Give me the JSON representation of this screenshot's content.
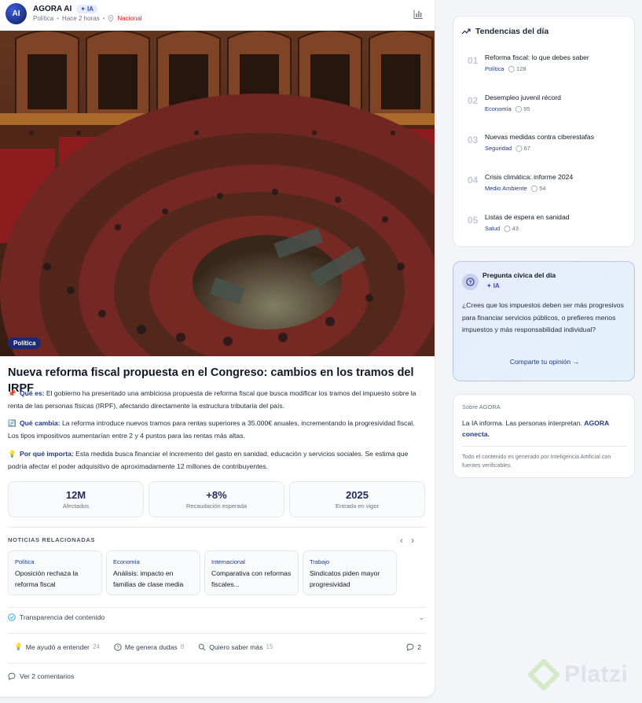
{
  "post": {
    "author": "AGORA AI",
    "avatar_initials": "AI",
    "ia_badge": "IA",
    "category": "Política",
    "time": "Hace 2 horas",
    "location": "Nacional",
    "image_category": "Política",
    "headline": "Nueva reforma fiscal propuesta en el Congreso: cambios en los tramos del IRPF",
    "sections": [
      {
        "label": "Qué es:",
        "text": "El gobierno ha presentado una ambiciosa propuesta de reforma fiscal que busca modificar los tramos del impuesto sobre la renta de las personas físicas (IRPF), afectando directamente la estructura tributaria del país."
      },
      {
        "label": "Qué cambia:",
        "text": "La reforma introduce nuevos tramos para rentas superiores a 35.000€ anuales, incrementando la progresividad fiscal. Los tipos impositivos aumentarían entre 2 y 4 puntos para las rentas más altas."
      },
      {
        "label": "Por qué importa:",
        "text": "Esta medida busca financiar el incremento del gasto en sanidad, educación y servicios sociales. Se estima que podría afectar el poder adquisitivo de aproximadamente 12 millones de contribuyentes."
      }
    ],
    "stats": [
      {
        "value": "12M",
        "label": "Afectados"
      },
      {
        "value": "+8%",
        "label": "Recaudación esperada"
      },
      {
        "value": "2025",
        "label": "Entrada en vigor"
      }
    ],
    "related_title": "NOTICIAS RELACIONADAS",
    "related": [
      {
        "category": "Política",
        "title": "Oposición rechaza la reforma fiscal"
      },
      {
        "category": "Economía",
        "title": "Análisis: impacto en familias de clase media"
      },
      {
        "category": "Internacional",
        "title": "Comparativa con reformas fiscales..."
      },
      {
        "category": "Trabajo",
        "title": "Sindicatos piden mayor progresividad"
      }
    ],
    "transparency": "Transparencia del contenido",
    "reactions": [
      {
        "label": "Me ayudó a entender",
        "count": "24"
      },
      {
        "label": "Me genera dudas",
        "count": "8"
      },
      {
        "label": "Quiero saber más",
        "count": "15"
      }
    ],
    "comment_count": "2",
    "see_comments": "Ver 2 comentarios"
  },
  "trends": {
    "title": "Tendencias del día",
    "items": [
      {
        "num": "01",
        "title": "Reforma fiscal: lo que debes saber",
        "category": "Política",
        "count": "128"
      },
      {
        "num": "02",
        "title": "Desempleo juvenil récord",
        "category": "Economía",
        "count": "95"
      },
      {
        "num": "03",
        "title": "Nuevas medidas contra ciberestafas",
        "category": "Seguridad",
        "count": "67"
      },
      {
        "num": "04",
        "title": "Crisis climática: informe 2024",
        "category": "Medio Ambiente",
        "count": "54"
      },
      {
        "num": "05",
        "title": "Listas de espera en sanidad",
        "category": "Salud",
        "count": "43"
      }
    ]
  },
  "question": {
    "title": "Pregunta cívica del día",
    "badge": "IA",
    "text": "¿Crees que los impuestos deben ser más progresivos para financiar servicios públicos, o prefieres menos impuestos y más responsabilidad individual?",
    "cta": "Comparte tu opinión →"
  },
  "about": {
    "label": "Sobre AGORA",
    "text_plain": "La IA informa. Las personas interpretan. ",
    "text_bold": "AGORA conecta.",
    "footnote": "Todo el contenido es generado por Inteligencia Artificial con fuentes verificables."
  },
  "watermark": "Platzi",
  "colors": {
    "accent": "#1e2a78",
    "link": "#1e3a8a",
    "location": "#dc2626"
  }
}
